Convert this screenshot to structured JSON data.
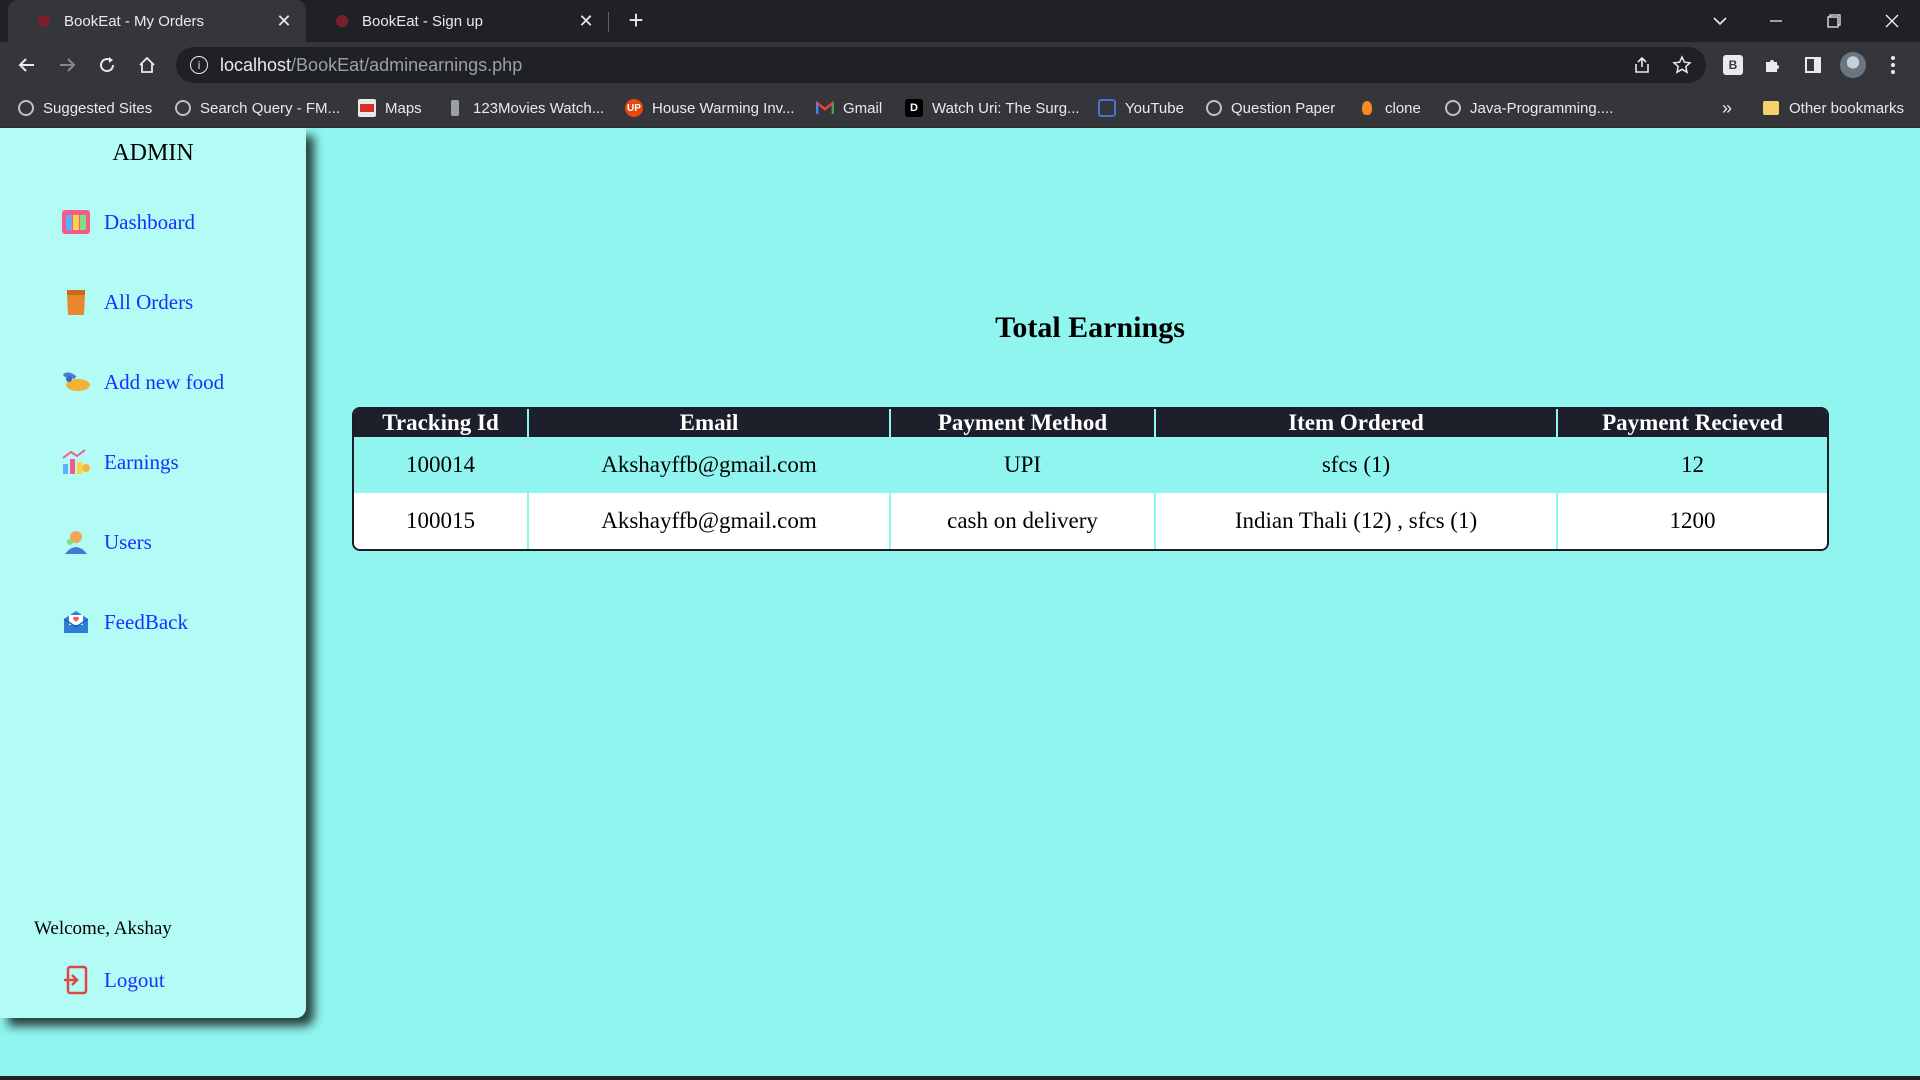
{
  "browser": {
    "tabs": [
      {
        "title": "BookEat - My Orders",
        "active": true
      },
      {
        "title": "BookEat - Sign up",
        "active": false
      }
    ],
    "url_host": "localhost",
    "url_path": "/BookEat/adminearnings.php",
    "profile_badge": "B",
    "bookmarks": [
      {
        "label": "Suggested Sites",
        "icon": "globe-icon"
      },
      {
        "label": "Search Query - FM...",
        "icon": "globe-icon"
      },
      {
        "label": "Maps",
        "icon": "maps-icon"
      },
      {
        "label": "123Movies Watch...",
        "icon": "movie-icon"
      },
      {
        "label": "House Warming Inv...",
        "icon": "up-icon"
      },
      {
        "label": "Gmail",
        "icon": "gmail-icon"
      },
      {
        "label": "Watch Uri: The Surg...",
        "icon": "d-icon"
      },
      {
        "label": "YouTube",
        "icon": "youtube-icon"
      },
      {
        "label": "Question Paper",
        "icon": "globe-icon"
      },
      {
        "label": "clone",
        "icon": "clone-icon"
      },
      {
        "label": "Java-Programming....",
        "icon": "globe-icon"
      }
    ],
    "more_bookmarks": "»",
    "other_bookmarks": "Other bookmarks"
  },
  "sidebar": {
    "title": "ADMIN",
    "items": [
      {
        "label": "Dashboard",
        "icon": "dashboard-icon"
      },
      {
        "label": "All Orders",
        "icon": "orders-icon"
      },
      {
        "label": "Add new food",
        "icon": "food-icon"
      },
      {
        "label": "Earnings",
        "icon": "earnings-icon"
      },
      {
        "label": "Users",
        "icon": "users-icon"
      },
      {
        "label": "FeedBack",
        "icon": "feedback-icon"
      }
    ],
    "welcome": "Welcome, Akshay",
    "logout": "Logout"
  },
  "main": {
    "title": "Total Earnings",
    "columns": [
      "Tracking Id",
      "Email",
      "Payment Method",
      "Item Ordered",
      "Payment Recieved"
    ],
    "rows": [
      [
        "100014",
        "Akshayffb@gmail.com",
        "UPI",
        "sfcs (1)",
        "12"
      ],
      [
        "100015",
        "Akshayffb@gmail.com",
        "cash on delivery",
        "Indian Thali (12) , sfcs (1)",
        "1200"
      ]
    ]
  },
  "colors": {
    "page_bg": "#8ff5ee",
    "sidebar_bg": "#b3fcf5",
    "link": "#1b2fff",
    "table_header": "#1d1f2b"
  }
}
